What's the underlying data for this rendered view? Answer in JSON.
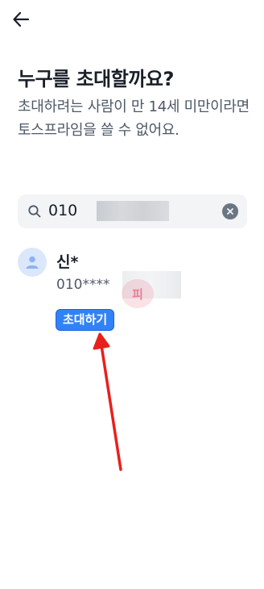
{
  "header": {
    "back_icon": "arrow-left-icon"
  },
  "title": "누구를 초대할까요?",
  "description": "초대하려는 사람이 만 14세 미만이라면 토스프라임을 쓸 수 없어요.",
  "search": {
    "icon": "search-icon",
    "value": "010",
    "clear_icon": "clear-icon"
  },
  "contact": {
    "avatar_icon": "person-icon",
    "name": "신*",
    "phone": "010****",
    "watermark": "피"
  },
  "invite_button": {
    "label": "초대하기"
  },
  "colors": {
    "primary": "#3182f6",
    "annotation_arrow": "#e8201c",
    "avatar_bg": "#dbe7fb",
    "search_bg": "#f2f4f6"
  }
}
